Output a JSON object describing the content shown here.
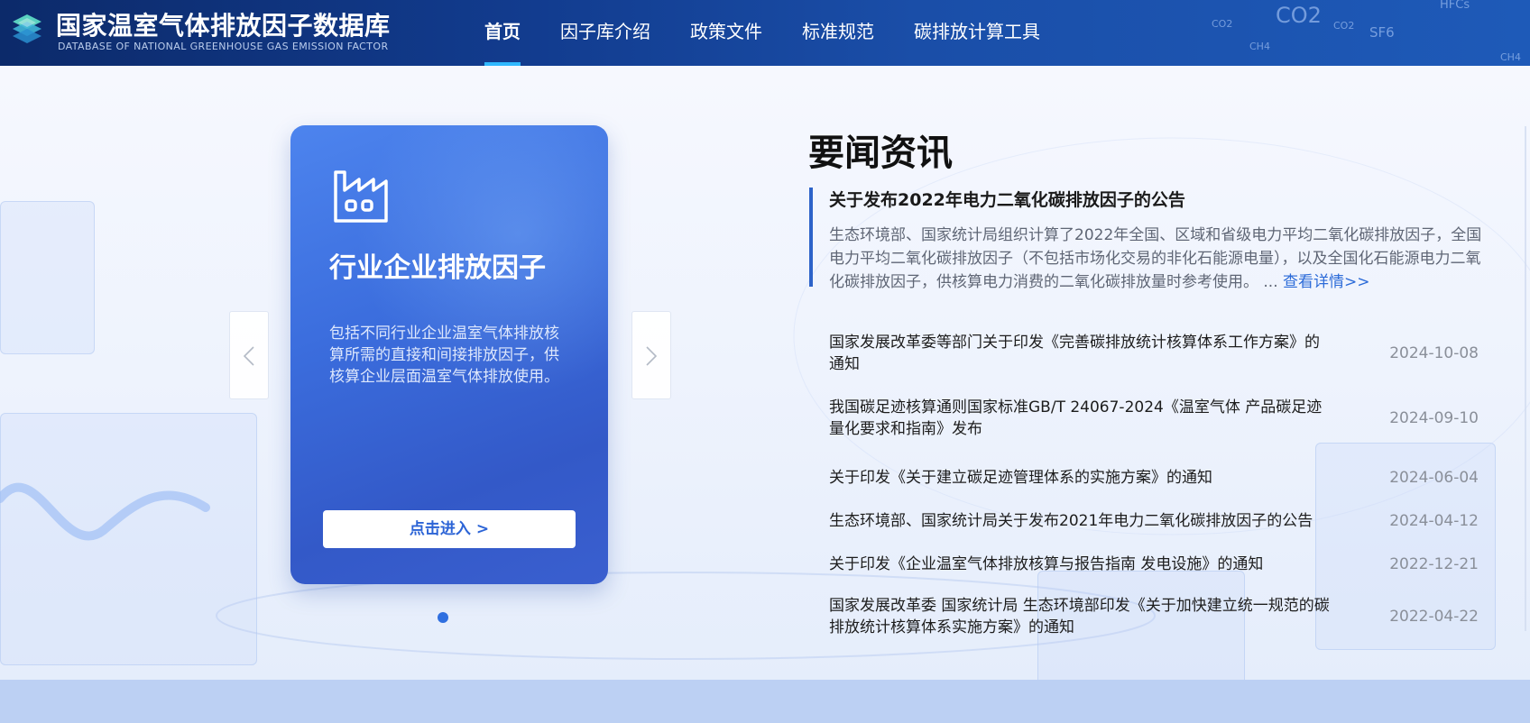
{
  "header": {
    "title": "国家温室气体排放因子数据库",
    "subtitle": "DATABASE OF NATIONAL GREENHOUSE GAS EMISSION FACTOR",
    "gas_labels": [
      "CO2",
      "CO2",
      "CO2",
      "SF6",
      "CH4",
      "HFCs",
      "CH4"
    ]
  },
  "nav": {
    "items": [
      {
        "label": "首页",
        "active": true
      },
      {
        "label": "因子库介绍",
        "active": false
      },
      {
        "label": "政策文件",
        "active": false
      },
      {
        "label": "标准规范",
        "active": false
      },
      {
        "label": "碳排放计算工具",
        "active": false
      }
    ]
  },
  "carousel": {
    "card": {
      "icon": "factory-icon",
      "title": "行业企业排放因子",
      "description": "包括不同行业企业温室气体排放核算所需的直接和间接排放因子，供核算企业层面温室气体排放使用。",
      "button": "点击进入 >"
    },
    "prev_icon": "chevron-left-icon",
    "next_icon": "chevron-right-icon",
    "active_dot": 1
  },
  "news": {
    "heading": "要闻资讯",
    "featured": {
      "title": "关于发布2022年电力二氧化碳排放因子的公告",
      "summary": "生态环境部、国家统计局组织计算了2022年全国、区域和省级电力平均二氧化碳排放因子，全国电力平均二氧化碳排放因子（不包括市场化交易的非化石能源电量），以及全国化石能源电力二氧化碳排放因子，供核算电力消费的二氧化碳排放量时参考使用。",
      "ellipsis": "...",
      "more": "查看详情>>"
    },
    "items": [
      {
        "title": "国家发展改革委等部门关于印发《完善碳排放统计核算体系工作方案》的通知",
        "date": "2024-10-08"
      },
      {
        "title": "我国碳足迹核算通则国家标准GB/T 24067-2024《温室气体 产品碳足迹 量化要求和指南》发布",
        "date": "2024-09-10"
      },
      {
        "title": "关于印发《关于建立碳足迹管理体系的实施方案》的通知",
        "date": "2024-06-04"
      },
      {
        "title": "生态环境部、国家统计局关于发布2021年电力二氧化碳排放因子的公告",
        "date": "2024-04-12"
      },
      {
        "title": "关于印发《企业温室气体排放核算与报告指南 发电设施》的通知",
        "date": "2022-12-21"
      },
      {
        "title": "国家发展改革委 国家统计局 生态环境部印发《关于加快建立统一规范的碳排放统计核算体系实施方案》的通知",
        "date": "2022-04-22"
      }
    ]
  },
  "colors": {
    "header_bg": "#123c8f",
    "nav_active_underline": "#2fb8ff",
    "card_bg": "#3b6ddd",
    "accent_blue": "#2c6bd8",
    "date_gray": "#8a8f99"
  }
}
